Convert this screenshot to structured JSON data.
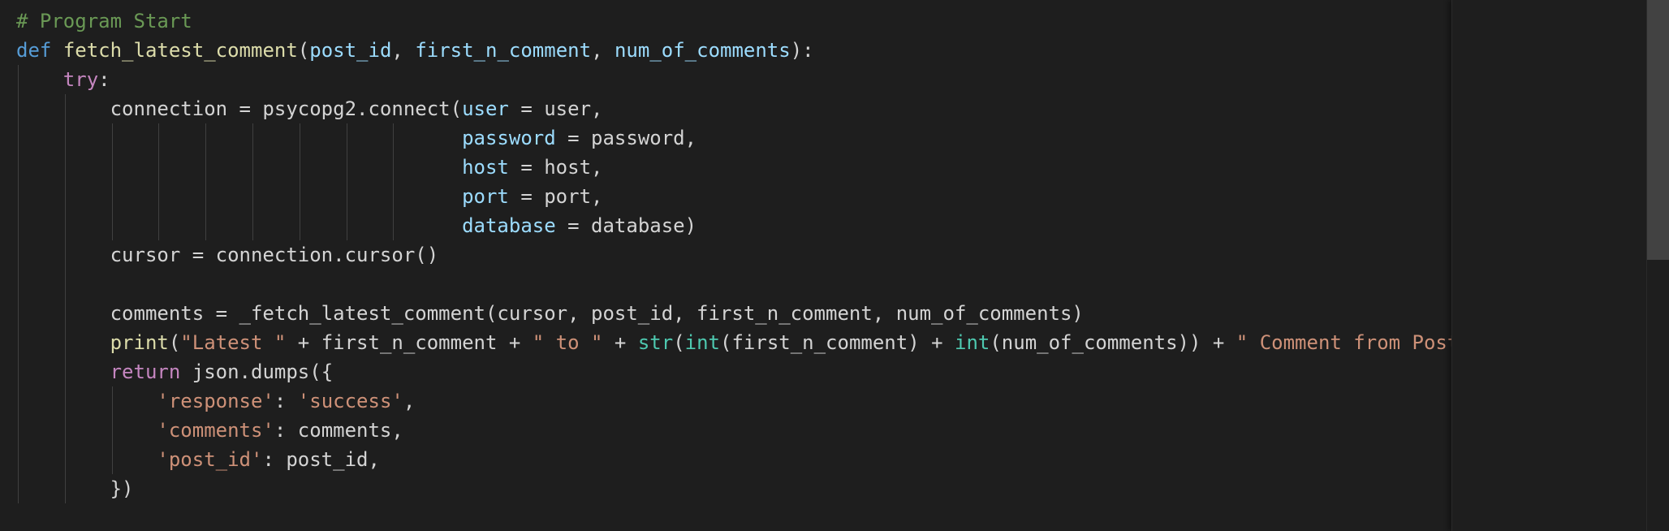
{
  "editor": {
    "lines": [
      [
        {
          "t": "# Program Start",
          "c": "comment"
        }
      ],
      [
        {
          "t": "def",
          "c": "kw"
        },
        {
          "t": " ",
          "c": "plain"
        },
        {
          "t": "fetch_latest_comment",
          "c": "fn"
        },
        {
          "t": "(",
          "c": "plain"
        },
        {
          "t": "post_id",
          "c": "param"
        },
        {
          "t": ", ",
          "c": "plain"
        },
        {
          "t": "first_n_comment",
          "c": "param"
        },
        {
          "t": ", ",
          "c": "plain"
        },
        {
          "t": "num_of_comments",
          "c": "param"
        },
        {
          "t": "):",
          "c": "plain"
        }
      ],
      [
        {
          "t": "    ",
          "c": "plain"
        },
        {
          "t": "try",
          "c": "ctrl"
        },
        {
          "t": ":",
          "c": "plain"
        }
      ],
      [
        {
          "t": "        connection = psycopg2.connect(",
          "c": "plain"
        },
        {
          "t": "user",
          "c": "param"
        },
        {
          "t": " = user,",
          "c": "plain"
        }
      ],
      [
        {
          "t": "                                      ",
          "c": "plain"
        },
        {
          "t": "password",
          "c": "param"
        },
        {
          "t": " = password,",
          "c": "plain"
        }
      ],
      [
        {
          "t": "                                      ",
          "c": "plain"
        },
        {
          "t": "host",
          "c": "param"
        },
        {
          "t": " = host,",
          "c": "plain"
        }
      ],
      [
        {
          "t": "                                      ",
          "c": "plain"
        },
        {
          "t": "port",
          "c": "param"
        },
        {
          "t": " = port,",
          "c": "plain"
        }
      ],
      [
        {
          "t": "                                      ",
          "c": "plain"
        },
        {
          "t": "database",
          "c": "param"
        },
        {
          "t": " = database)",
          "c": "plain"
        }
      ],
      [
        {
          "t": "        cursor = connection.cursor()",
          "c": "plain"
        }
      ],
      [],
      [
        {
          "t": "        comments = _fetch_latest_comment(cursor, post_id, first_n_comment, num_of_comments)",
          "c": "plain"
        }
      ],
      [
        {
          "t": "        ",
          "c": "plain"
        },
        {
          "t": "print",
          "c": "fn"
        },
        {
          "t": "(",
          "c": "plain"
        },
        {
          "t": "\"Latest \"",
          "c": "str"
        },
        {
          "t": " + first_n_comment + ",
          "c": "plain"
        },
        {
          "t": "\" to \"",
          "c": "str"
        },
        {
          "t": " + ",
          "c": "plain"
        },
        {
          "t": "str",
          "c": "builtin"
        },
        {
          "t": "(",
          "c": "plain"
        },
        {
          "t": "int",
          "c": "builtin"
        },
        {
          "t": "(first_n_comment) + ",
          "c": "plain"
        },
        {
          "t": "int",
          "c": "builtin"
        },
        {
          "t": "(num_of_comments)) + ",
          "c": "plain"
        },
        {
          "t": "\" Comment from Post",
          "c": "str"
        }
      ],
      [
        {
          "t": "        ",
          "c": "plain"
        },
        {
          "t": "return",
          "c": "ctrl"
        },
        {
          "t": " json.dumps({",
          "c": "plain"
        }
      ],
      [
        {
          "t": "            ",
          "c": "plain"
        },
        {
          "t": "'response'",
          "c": "str"
        },
        {
          "t": ": ",
          "c": "plain"
        },
        {
          "t": "'success'",
          "c": "str"
        },
        {
          "t": ",",
          "c": "plain"
        }
      ],
      [
        {
          "t": "            ",
          "c": "plain"
        },
        {
          "t": "'comments'",
          "c": "str"
        },
        {
          "t": ": comments,",
          "c": "plain"
        }
      ],
      [
        {
          "t": "            ",
          "c": "plain"
        },
        {
          "t": "'post_id'",
          "c": "str"
        },
        {
          "t": ": post_id,",
          "c": "plain"
        }
      ],
      [
        {
          "t": "        })",
          "c": "plain"
        }
      ]
    ]
  },
  "colors": {
    "background": "#1e1e1e",
    "comment": "#6a9955",
    "keyword": "#569cd6",
    "control": "#c586c0",
    "function": "#dcdcaa",
    "parameter": "#9cdcfe",
    "string": "#ce9178",
    "builtin": "#4ec9b0",
    "text": "#d4d4d4"
  }
}
